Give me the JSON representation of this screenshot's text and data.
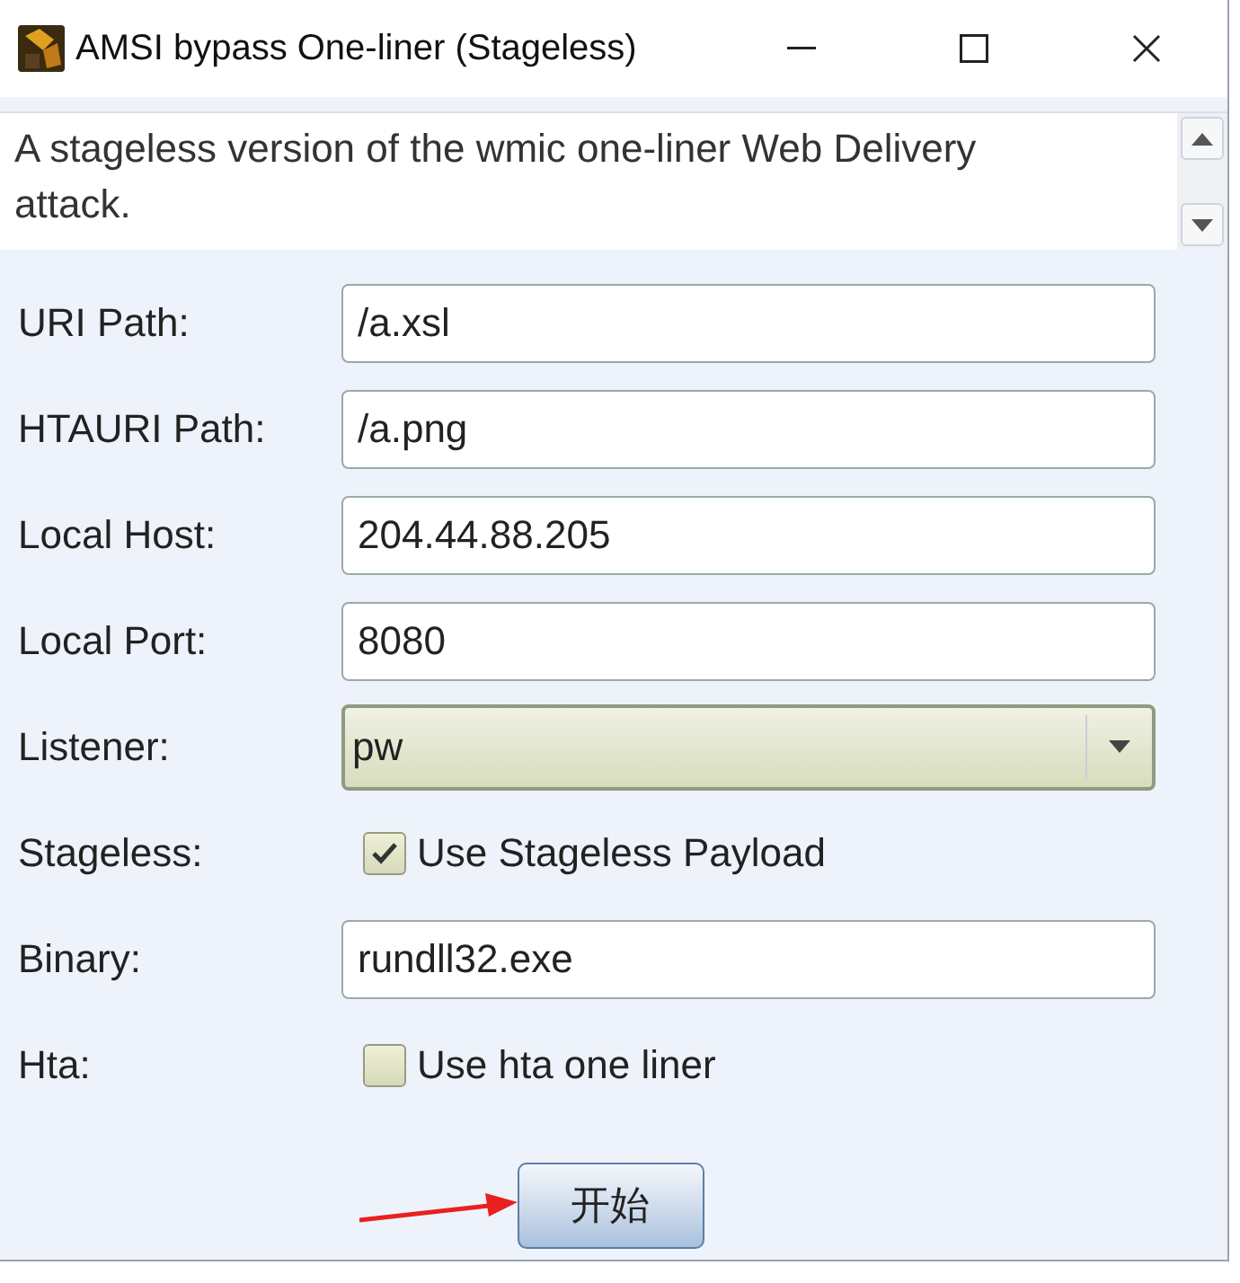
{
  "window": {
    "title": "AMSI bypass One-liner (Stageless)"
  },
  "description": "A stageless version of the wmic one-liner Web Delivery attack.",
  "fields": [
    {
      "label": "URI Path:",
      "kind": "text",
      "value": "/a.xsl"
    },
    {
      "label": "HTAURI Path:",
      "kind": "text",
      "value": "/a.png"
    },
    {
      "label": "Local Host:",
      "kind": "text",
      "value": "204.44.88.205"
    },
    {
      "label": "Local Port:",
      "kind": "text",
      "value": "8080"
    },
    {
      "label": "Listener:",
      "kind": "select",
      "value": "pw"
    },
    {
      "label": "Stageless:",
      "kind": "checkbox",
      "text": "Use Stageless Payload",
      "checked": true
    },
    {
      "label": "Binary:",
      "kind": "text",
      "value": "rundll32.exe"
    },
    {
      "label": "Hta:",
      "kind": "checkbox",
      "text": "Use hta one liner",
      "checked": false
    }
  ],
  "button": "开始"
}
